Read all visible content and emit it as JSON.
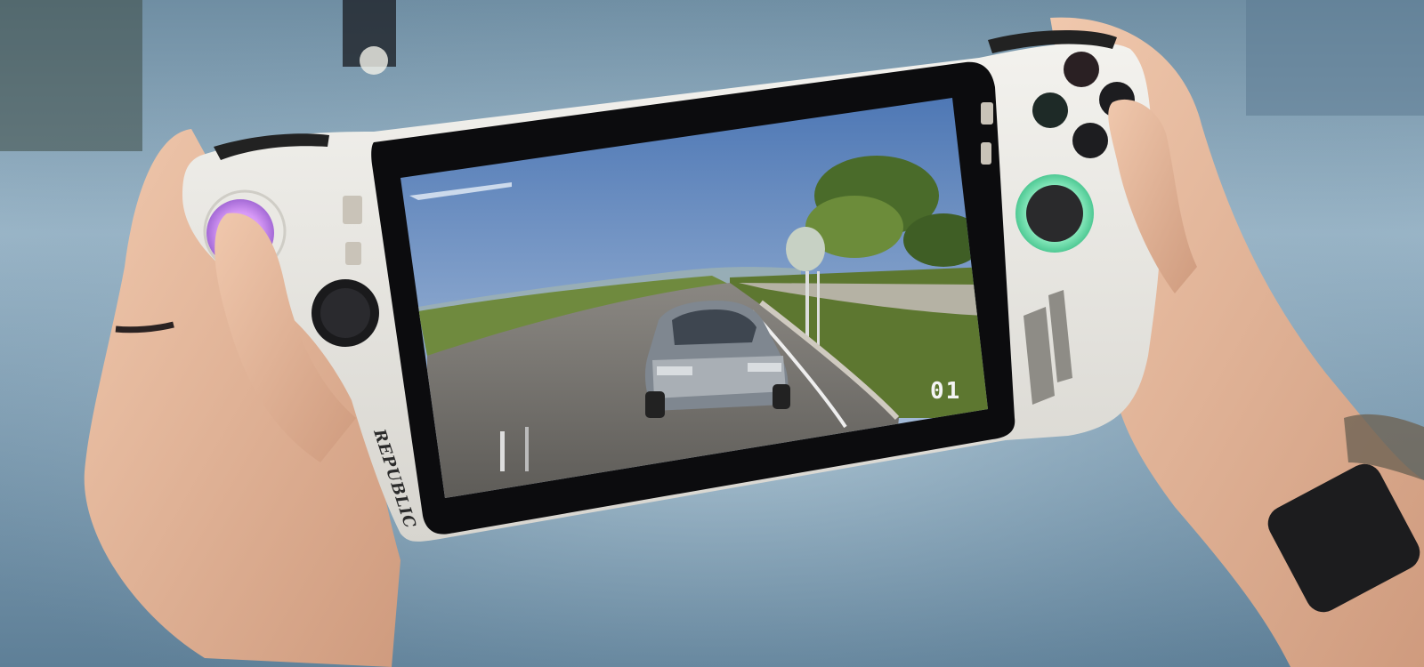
{
  "scene": {
    "colors": {
      "background_top": "#7e9db1",
      "background_bottom": "#a8c2d3",
      "device_body": "#e9e8e3",
      "bezel": "#0c0c0e",
      "left_stick_ring": "#c77cf0",
      "right_stick_ring": "#7cf0b8",
      "sky": "#5f88c2",
      "grass": "#6b7f3a",
      "road": "#77756f",
      "skin": "#e7b99c"
    },
    "icons": [
      "left-thumbstick-icon",
      "right-thumbstick-icon",
      "face-buttons-icon",
      "dpad-icon",
      "car-icon",
      "tree-icon"
    ]
  },
  "hud": {
    "counter": "01"
  },
  "device": {
    "side_lettering": "REPUBLIC"
  }
}
